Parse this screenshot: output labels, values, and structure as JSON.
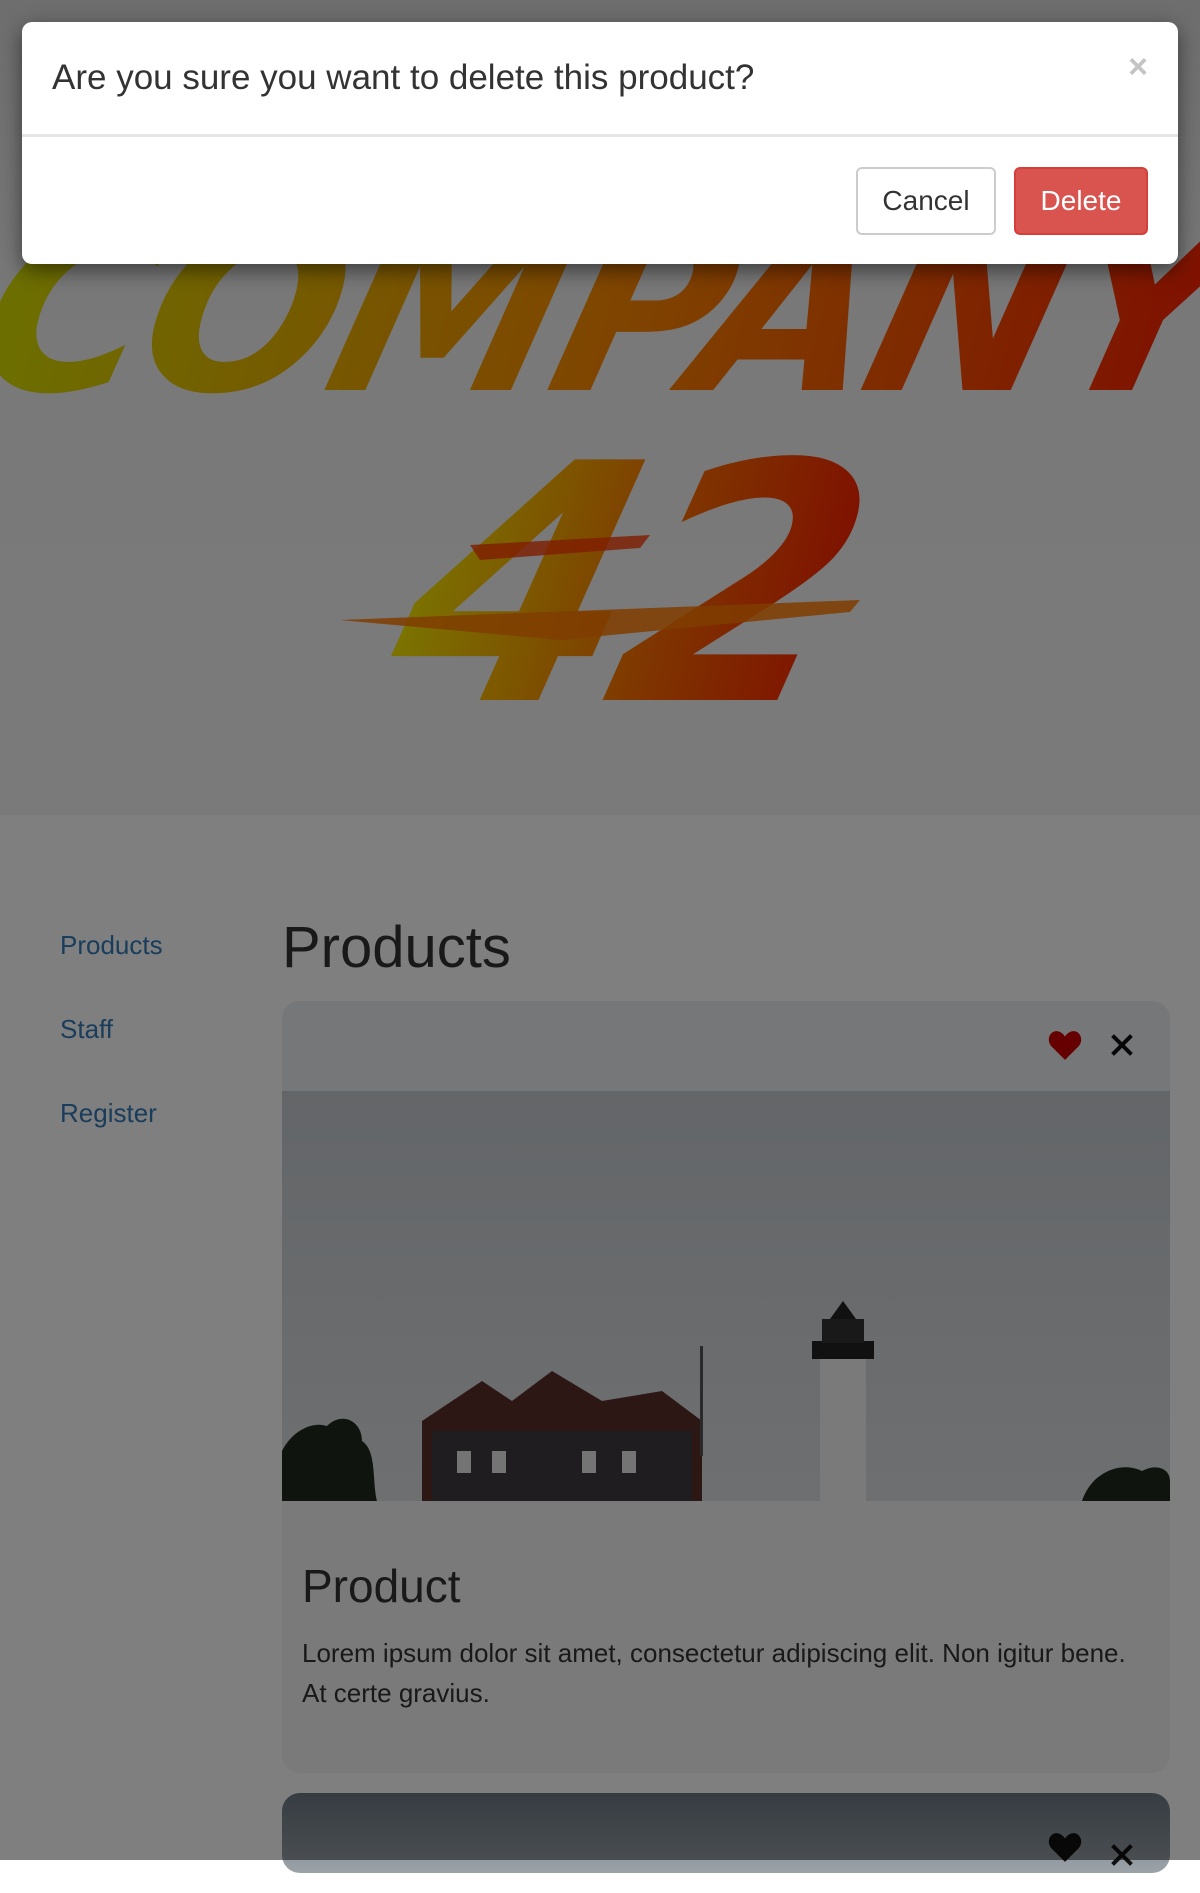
{
  "modal": {
    "title": "Are you sure you want to delete this product?",
    "close_symbol": "×",
    "cancel_label": "Cancel",
    "delete_label": "Delete"
  },
  "logo": {
    "line1": "COMPANY",
    "line2": "42",
    "gradient_from": "#d7e100",
    "gradient_to": "#ff1a00"
  },
  "sidebar": {
    "items": [
      {
        "label": "Products"
      },
      {
        "label": "Staff"
      },
      {
        "label": "Register"
      }
    ]
  },
  "main": {
    "title": "Products",
    "cards": [
      {
        "title": "Product",
        "description": "Lorem ipsum dolor sit amet, consectetur adipiscing elit. Non igitur bene. At certe gravius.",
        "favorite_color": "#cc0000",
        "icons": [
          "heart-icon",
          "close-icon"
        ]
      },
      {
        "favorite_color": "#111111",
        "icons": [
          "heart-icon",
          "close-icon"
        ]
      }
    ]
  },
  "colors": {
    "link": "#337ab7",
    "danger": "#d9534f"
  }
}
